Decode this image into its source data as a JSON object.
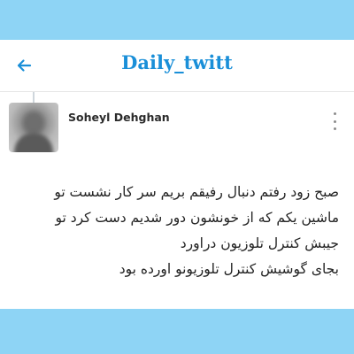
{
  "header": {
    "title": "Daily_twitt",
    "back_icon": "arrow-left-icon"
  },
  "tweet": {
    "author": "Soheyl Dehghan",
    "avatar": "blurred-profile-photo",
    "more_icon": "more-vertical-icon",
    "text": "صبح زود رفتم دنبال رفیقم بریم سر کار  نشست تو\nماشین یکم که از خونشون دور شدیم دست کرد تو\nجیبش کنترل تلوزیون دراورد\nبجای گوشیش کنترل تلوزیونو اورده بود"
  },
  "colors": {
    "frame": "#8ed4f5",
    "accent": "#1a8fd8",
    "text": "#222222"
  }
}
